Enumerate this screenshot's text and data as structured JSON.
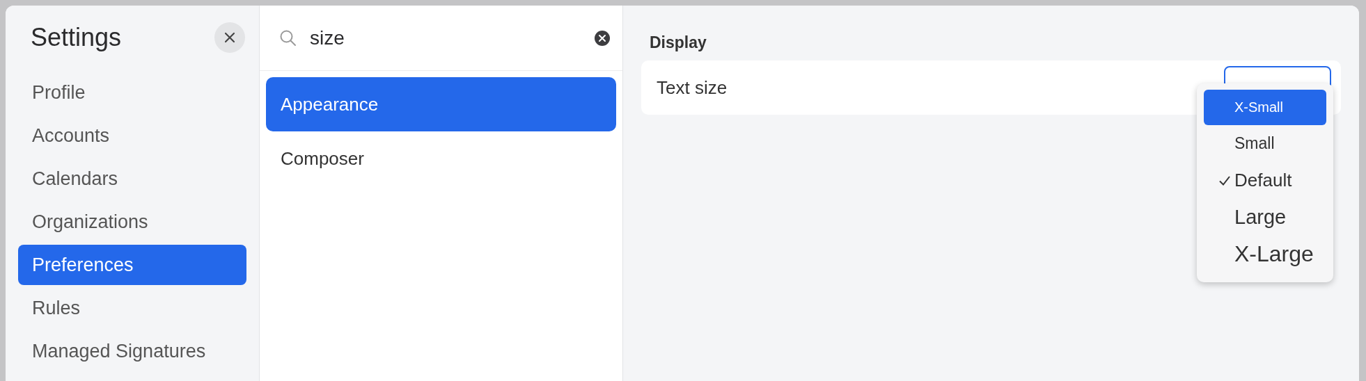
{
  "sidebar": {
    "title": "Settings",
    "items": [
      {
        "label": "Profile",
        "selected": false
      },
      {
        "label": "Accounts",
        "selected": false
      },
      {
        "label": "Calendars",
        "selected": false
      },
      {
        "label": "Organizations",
        "selected": false
      },
      {
        "label": "Preferences",
        "selected": true
      },
      {
        "label": "Rules",
        "selected": false
      },
      {
        "label": "Managed Signatures",
        "selected": false
      }
    ]
  },
  "search": {
    "value": "size"
  },
  "results": [
    {
      "label": "Appearance",
      "selected": true
    },
    {
      "label": "Composer",
      "selected": false
    }
  ],
  "section": {
    "title": "Display",
    "rows": [
      {
        "label": "Text size"
      }
    ]
  },
  "dropdown": {
    "options": [
      {
        "label": "X-Small",
        "selected": true,
        "checked": false
      },
      {
        "label": "Small",
        "selected": false,
        "checked": false
      },
      {
        "label": "Default",
        "selected": false,
        "checked": true
      },
      {
        "label": "Large",
        "selected": false,
        "checked": false
      },
      {
        "label": "X-Large",
        "selected": false,
        "checked": false
      }
    ]
  }
}
